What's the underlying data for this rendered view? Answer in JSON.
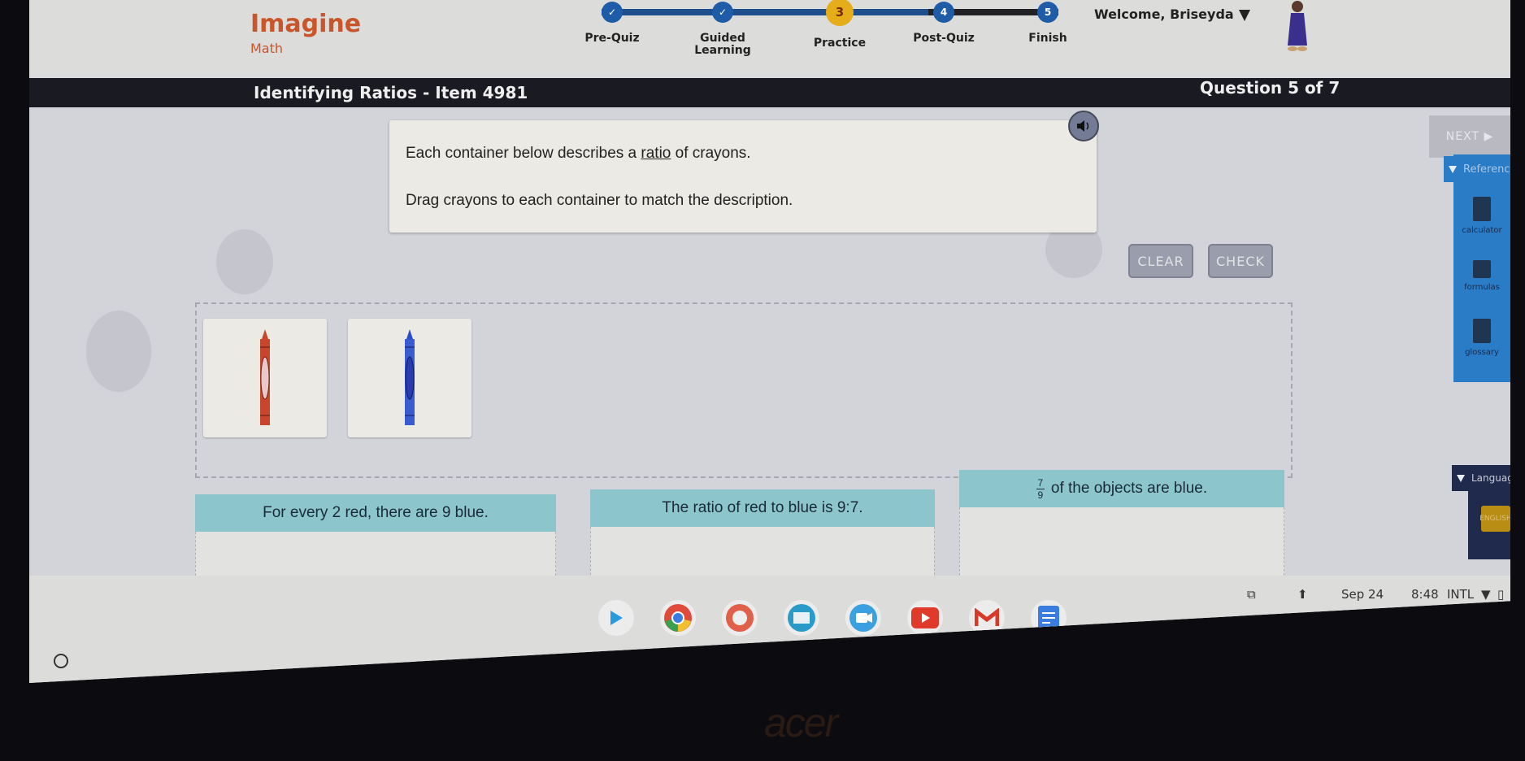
{
  "header": {
    "brand_title": "Imagine",
    "brand_subtitle": "Math",
    "welcome": "Welcome, Briseyda",
    "steps": [
      {
        "label": "Pre-Quiz",
        "number": "1",
        "status": "complete"
      },
      {
        "label": "Guided Learning",
        "number": "2",
        "status": "complete"
      },
      {
        "label": "Practice",
        "number": "3",
        "status": "current"
      },
      {
        "label": "Post-Quiz",
        "number": "4",
        "status": "upcoming"
      },
      {
        "label": "Finish",
        "number": "5",
        "status": "upcoming"
      }
    ]
  },
  "title_bar": {
    "lesson": "Identifying Ratios - Item 4981",
    "question_count": "Question 5 of 7"
  },
  "prompt": {
    "line1_pre": "Each container below describes a ",
    "line1_link": "ratio",
    "line1_post": " of crayons.",
    "line2": "Drag crayons to each container to match the description."
  },
  "buttons": {
    "next": "NEXT ▶",
    "clear": "CLEAR",
    "check": "CHECK"
  },
  "crayon_bank": [
    {
      "color_name": "red",
      "color": "#c8462c"
    },
    {
      "color_name": "blue",
      "color": "#2a4cc8"
    }
  ],
  "targets": [
    {
      "text": "For every 2 red, there are 9 blue."
    },
    {
      "text": "The ratio of red to blue is 9:7."
    },
    {
      "fraction_num": "7",
      "fraction_den": "9",
      "text": "of the objects are blue."
    }
  ],
  "reference_panel": {
    "title": "Reference",
    "items": [
      "calculator",
      "formulas",
      "glossary"
    ]
  },
  "language_panel": {
    "title": "Language",
    "button": "ENGLISH"
  },
  "shelf": {
    "apps": [
      "play-store",
      "chrome",
      "quizlet",
      "classroom",
      "meet",
      "youtube",
      "gmail",
      "docs"
    ],
    "date": "Sep 24",
    "time": "8:48",
    "input": "INTL"
  },
  "bezel_brand": "acer",
  "colors": {
    "brand_orange": "#c8562a",
    "step_blue": "#1e5ca8",
    "step_current": "#e6ad1a",
    "target_header": "#8cc6cc",
    "reference_blue": "#2a7cc7"
  }
}
